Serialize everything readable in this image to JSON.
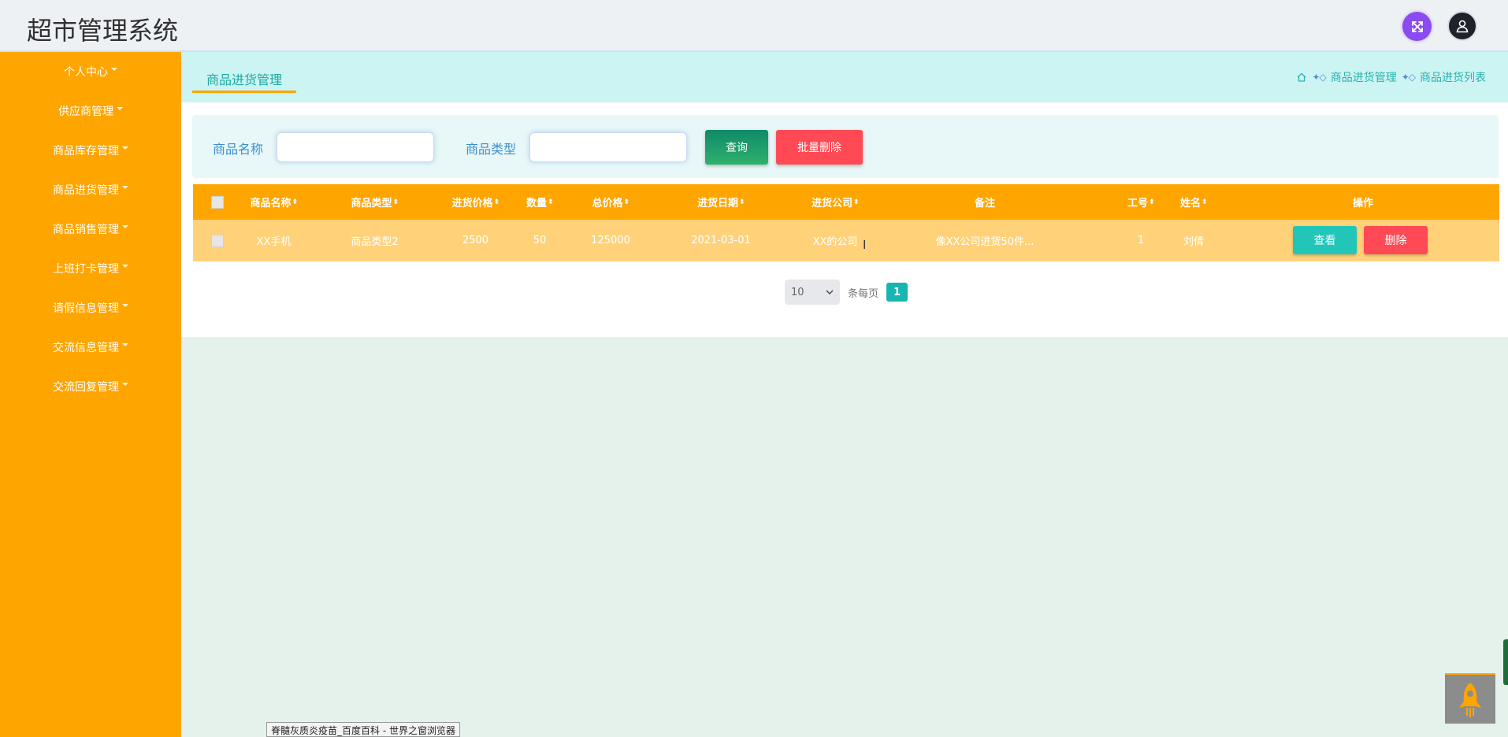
{
  "header": {
    "app_title": "超市管理系统",
    "fullscreen_icon": "expand-arrows-icon",
    "user_icon": "user-avatar-icon"
  },
  "sidebar": {
    "items": [
      {
        "label": "个人中心"
      },
      {
        "label": "供应商管理"
      },
      {
        "label": "商品库存管理"
      },
      {
        "label": "商品进货管理"
      },
      {
        "label": "商品销售管理"
      },
      {
        "label": "上班打卡管理"
      },
      {
        "label": "请假信息管理"
      },
      {
        "label": "交流信息管理"
      },
      {
        "label": "交流回复管理"
      }
    ]
  },
  "tabs": {
    "active_label": "商品进货管理"
  },
  "breadcrumb": {
    "level1": "商品进货管理",
    "level2": "商品进货列表"
  },
  "search": {
    "name_label": "商品名称",
    "name_value": "",
    "type_label": "商品类型",
    "type_value": "",
    "query_label": "查询",
    "batch_delete_label": "批量删除"
  },
  "table": {
    "headers": {
      "name": "商品名称",
      "type": "商品类型",
      "purchase_price": "进货价格",
      "quantity": "数量",
      "total_price": "总价格",
      "purchase_date": "进货日期",
      "supplier": "进货公司",
      "remarks": "备注",
      "employee_no": "工号",
      "employee_name": "姓名",
      "actions": "操作"
    },
    "rows": [
      {
        "name": "XX手机",
        "type": "商品类型2",
        "purchase_price": "2500",
        "quantity": "50",
        "total_price": "125000",
        "purchase_date": "2021-03-01",
        "supplier": "XX的公司",
        "remarks": "像XX公司进货50件...",
        "employee_no": "1",
        "employee_name": "刘倩",
        "view_label": "查看",
        "delete_label": "删除"
      }
    ]
  },
  "pagination": {
    "page_size": "10",
    "per_page_text": "条每页",
    "current_page": "1"
  },
  "statusbar": {
    "text": "脊髓灰质炎疫苗_百度百科 - 世界之窗浏览器"
  },
  "colors": {
    "sidebar_bg": "#ffa500",
    "table_header_bg": "#ffa500",
    "table_row_bg": "#ffd27a",
    "accent_teal": "#18b6b0",
    "danger": "#ff4a55"
  }
}
